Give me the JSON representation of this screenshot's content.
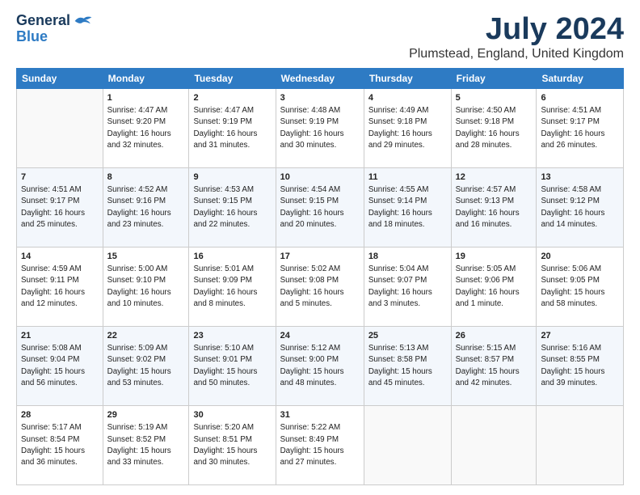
{
  "logo": {
    "line1": "General",
    "line2": "Blue",
    "bird_unicode": "🐦"
  },
  "title": "July 2024",
  "subtitle": "Plumstead, England, United Kingdom",
  "header_days": [
    "Sunday",
    "Monday",
    "Tuesday",
    "Wednesday",
    "Thursday",
    "Friday",
    "Saturday"
  ],
  "weeks": [
    [
      {
        "day": "",
        "info": ""
      },
      {
        "day": "1",
        "info": "Sunrise: 4:47 AM\nSunset: 9:20 PM\nDaylight: 16 hours\nand 32 minutes."
      },
      {
        "day": "2",
        "info": "Sunrise: 4:47 AM\nSunset: 9:19 PM\nDaylight: 16 hours\nand 31 minutes."
      },
      {
        "day": "3",
        "info": "Sunrise: 4:48 AM\nSunset: 9:19 PM\nDaylight: 16 hours\nand 30 minutes."
      },
      {
        "day": "4",
        "info": "Sunrise: 4:49 AM\nSunset: 9:18 PM\nDaylight: 16 hours\nand 29 minutes."
      },
      {
        "day": "5",
        "info": "Sunrise: 4:50 AM\nSunset: 9:18 PM\nDaylight: 16 hours\nand 28 minutes."
      },
      {
        "day": "6",
        "info": "Sunrise: 4:51 AM\nSunset: 9:17 PM\nDaylight: 16 hours\nand 26 minutes."
      }
    ],
    [
      {
        "day": "7",
        "info": "Sunrise: 4:51 AM\nSunset: 9:17 PM\nDaylight: 16 hours\nand 25 minutes."
      },
      {
        "day": "8",
        "info": "Sunrise: 4:52 AM\nSunset: 9:16 PM\nDaylight: 16 hours\nand 23 minutes."
      },
      {
        "day": "9",
        "info": "Sunrise: 4:53 AM\nSunset: 9:15 PM\nDaylight: 16 hours\nand 22 minutes."
      },
      {
        "day": "10",
        "info": "Sunrise: 4:54 AM\nSunset: 9:15 PM\nDaylight: 16 hours\nand 20 minutes."
      },
      {
        "day": "11",
        "info": "Sunrise: 4:55 AM\nSunset: 9:14 PM\nDaylight: 16 hours\nand 18 minutes."
      },
      {
        "day": "12",
        "info": "Sunrise: 4:57 AM\nSunset: 9:13 PM\nDaylight: 16 hours\nand 16 minutes."
      },
      {
        "day": "13",
        "info": "Sunrise: 4:58 AM\nSunset: 9:12 PM\nDaylight: 16 hours\nand 14 minutes."
      }
    ],
    [
      {
        "day": "14",
        "info": "Sunrise: 4:59 AM\nSunset: 9:11 PM\nDaylight: 16 hours\nand 12 minutes."
      },
      {
        "day": "15",
        "info": "Sunrise: 5:00 AM\nSunset: 9:10 PM\nDaylight: 16 hours\nand 10 minutes."
      },
      {
        "day": "16",
        "info": "Sunrise: 5:01 AM\nSunset: 9:09 PM\nDaylight: 16 hours\nand 8 minutes."
      },
      {
        "day": "17",
        "info": "Sunrise: 5:02 AM\nSunset: 9:08 PM\nDaylight: 16 hours\nand 5 minutes."
      },
      {
        "day": "18",
        "info": "Sunrise: 5:04 AM\nSunset: 9:07 PM\nDaylight: 16 hours\nand 3 minutes."
      },
      {
        "day": "19",
        "info": "Sunrise: 5:05 AM\nSunset: 9:06 PM\nDaylight: 16 hours\nand 1 minute."
      },
      {
        "day": "20",
        "info": "Sunrise: 5:06 AM\nSunset: 9:05 PM\nDaylight: 15 hours\nand 58 minutes."
      }
    ],
    [
      {
        "day": "21",
        "info": "Sunrise: 5:08 AM\nSunset: 9:04 PM\nDaylight: 15 hours\nand 56 minutes."
      },
      {
        "day": "22",
        "info": "Sunrise: 5:09 AM\nSunset: 9:02 PM\nDaylight: 15 hours\nand 53 minutes."
      },
      {
        "day": "23",
        "info": "Sunrise: 5:10 AM\nSunset: 9:01 PM\nDaylight: 15 hours\nand 50 minutes."
      },
      {
        "day": "24",
        "info": "Sunrise: 5:12 AM\nSunset: 9:00 PM\nDaylight: 15 hours\nand 48 minutes."
      },
      {
        "day": "25",
        "info": "Sunrise: 5:13 AM\nSunset: 8:58 PM\nDaylight: 15 hours\nand 45 minutes."
      },
      {
        "day": "26",
        "info": "Sunrise: 5:15 AM\nSunset: 8:57 PM\nDaylight: 15 hours\nand 42 minutes."
      },
      {
        "day": "27",
        "info": "Sunrise: 5:16 AM\nSunset: 8:55 PM\nDaylight: 15 hours\nand 39 minutes."
      }
    ],
    [
      {
        "day": "28",
        "info": "Sunrise: 5:17 AM\nSunset: 8:54 PM\nDaylight: 15 hours\nand 36 minutes."
      },
      {
        "day": "29",
        "info": "Sunrise: 5:19 AM\nSunset: 8:52 PM\nDaylight: 15 hours\nand 33 minutes."
      },
      {
        "day": "30",
        "info": "Sunrise: 5:20 AM\nSunset: 8:51 PM\nDaylight: 15 hours\nand 30 minutes."
      },
      {
        "day": "31",
        "info": "Sunrise: 5:22 AM\nSunset: 8:49 PM\nDaylight: 15 hours\nand 27 minutes."
      },
      {
        "day": "",
        "info": ""
      },
      {
        "day": "",
        "info": ""
      },
      {
        "day": "",
        "info": ""
      }
    ]
  ]
}
